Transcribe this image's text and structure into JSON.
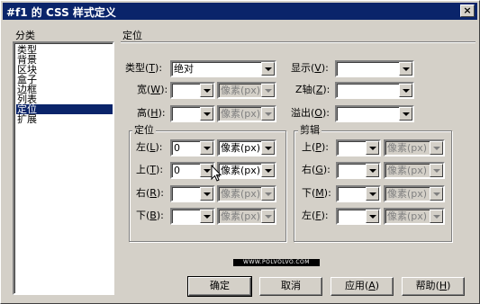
{
  "window": {
    "title": "#f1 的 CSS 样式定义",
    "close": "×"
  },
  "category": {
    "label": "分类",
    "items": [
      "类型",
      "背景",
      "区块",
      "盒子",
      "边框",
      "列表",
      "定位",
      "扩展"
    ],
    "selected_index": 6
  },
  "panel": {
    "title": "定位"
  },
  "fields": {
    "type": {
      "label": "类型",
      "key": "T",
      "value": "绝对"
    },
    "display": {
      "label": "显示",
      "key": "V",
      "value": ""
    },
    "width": {
      "label": "宽",
      "key": "W",
      "value": "",
      "unit": "像素(px)"
    },
    "zindex": {
      "label": "Z轴",
      "key": "Z",
      "value": ""
    },
    "height": {
      "label": "高",
      "key": "H",
      "value": "",
      "unit": "像素(px)"
    },
    "overflow": {
      "label": "溢出",
      "key": "O",
      "value": ""
    }
  },
  "placement": {
    "title": "定位",
    "rows": [
      {
        "label": "左",
        "key": "L",
        "value": "0",
        "unit": "像素(px)"
      },
      {
        "label": "上",
        "key": "T",
        "value": "0",
        "unit": "像素(px)"
      },
      {
        "label": "右",
        "key": "R",
        "value": "",
        "unit": "像素(px)"
      },
      {
        "label": "下",
        "key": "B",
        "value": "",
        "unit": "像素(px)"
      }
    ]
  },
  "clip": {
    "title": "剪辑",
    "rows": [
      {
        "label": "上",
        "key": "P",
        "value": "",
        "unit": "像素(px)"
      },
      {
        "label": "右",
        "key": "G",
        "value": "",
        "unit": "像素(px)"
      },
      {
        "label": "下",
        "key": "M",
        "value": "",
        "unit": "像素(px)"
      },
      {
        "label": "左",
        "key": "F",
        "value": "",
        "unit": "像素(px)"
      }
    ]
  },
  "watermark": "WWW.POLVOLVO.COM",
  "buttons": {
    "ok": "确定",
    "cancel": "取消",
    "apply": {
      "label": "应用",
      "key": "A"
    },
    "help": {
      "label": "帮助",
      "key": "H"
    }
  }
}
